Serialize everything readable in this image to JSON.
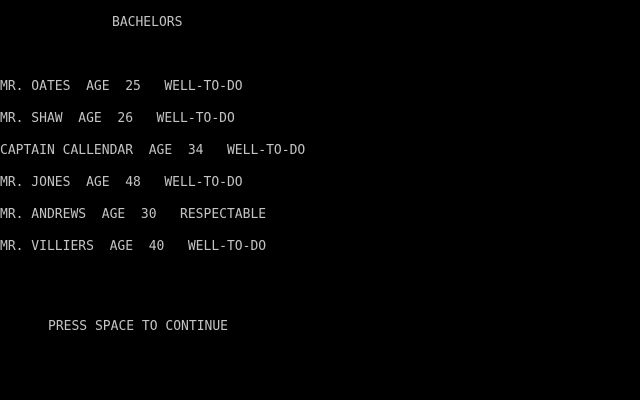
{
  "screen": {
    "title": "BACHELORS",
    "prompt": "PRESS SPACE TO CONTINUE",
    "colors": {
      "background": "#000000",
      "text": "#c4c4c4"
    }
  },
  "bachelors": [
    {
      "text": "MR. OATES  AGE  25   WELL-TO-DO"
    },
    {
      "text": "MR. SHAW  AGE  26   WELL-TO-DO"
    },
    {
      "text": "CAPTAIN CALLENDAR  AGE  34   WELL-TO-DO"
    },
    {
      "text": "MR. JONES  AGE  48   WELL-TO-DO"
    },
    {
      "text": "MR. ANDREWS  AGE  30   RESPECTABLE"
    },
    {
      "text": "MR. VILLIERS  AGE  40   WELL-TO-DO"
    }
  ]
}
